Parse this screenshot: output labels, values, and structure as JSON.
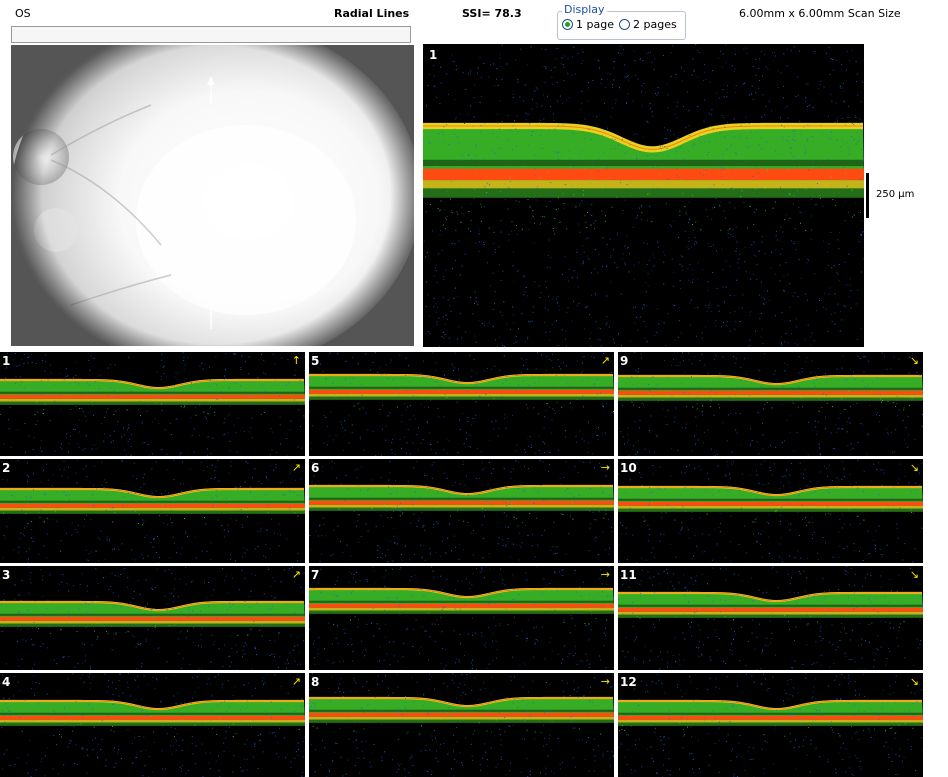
{
  "header": {
    "eye": "OS",
    "scan_type": "Radial Lines",
    "ssi": "SSI= 78.3",
    "scan_size": "6.00mm x 6.00mm Scan Size"
  },
  "display": {
    "legend": "Display",
    "options": [
      {
        "label": "1 page",
        "selected": true
      },
      {
        "label": "2 pages",
        "selected": false
      }
    ]
  },
  "main_scan": {
    "number": "1",
    "scale_label": "250 µm"
  },
  "thumbnails": [
    {
      "number": "1",
      "arrow": "↑"
    },
    {
      "number": "2",
      "arrow": "↗"
    },
    {
      "number": "3",
      "arrow": "↗"
    },
    {
      "number": "4",
      "arrow": "↗"
    },
    {
      "number": "5",
      "arrow": "↗"
    },
    {
      "number": "6",
      "arrow": "→"
    },
    {
      "number": "7",
      "arrow": "→"
    },
    {
      "number": "8",
      "arrow": "→"
    },
    {
      "number": "9",
      "arrow": "↘"
    },
    {
      "number": "10",
      "arrow": "↘"
    },
    {
      "number": "11",
      "arrow": "↘"
    },
    {
      "number": "12",
      "arrow": "↘"
    }
  ],
  "colors": {
    "rnfl": "#e8d21e",
    "retina": "#3fcb2c",
    "rpe": "#ff4a12",
    "speckle": "#1a63d6"
  }
}
